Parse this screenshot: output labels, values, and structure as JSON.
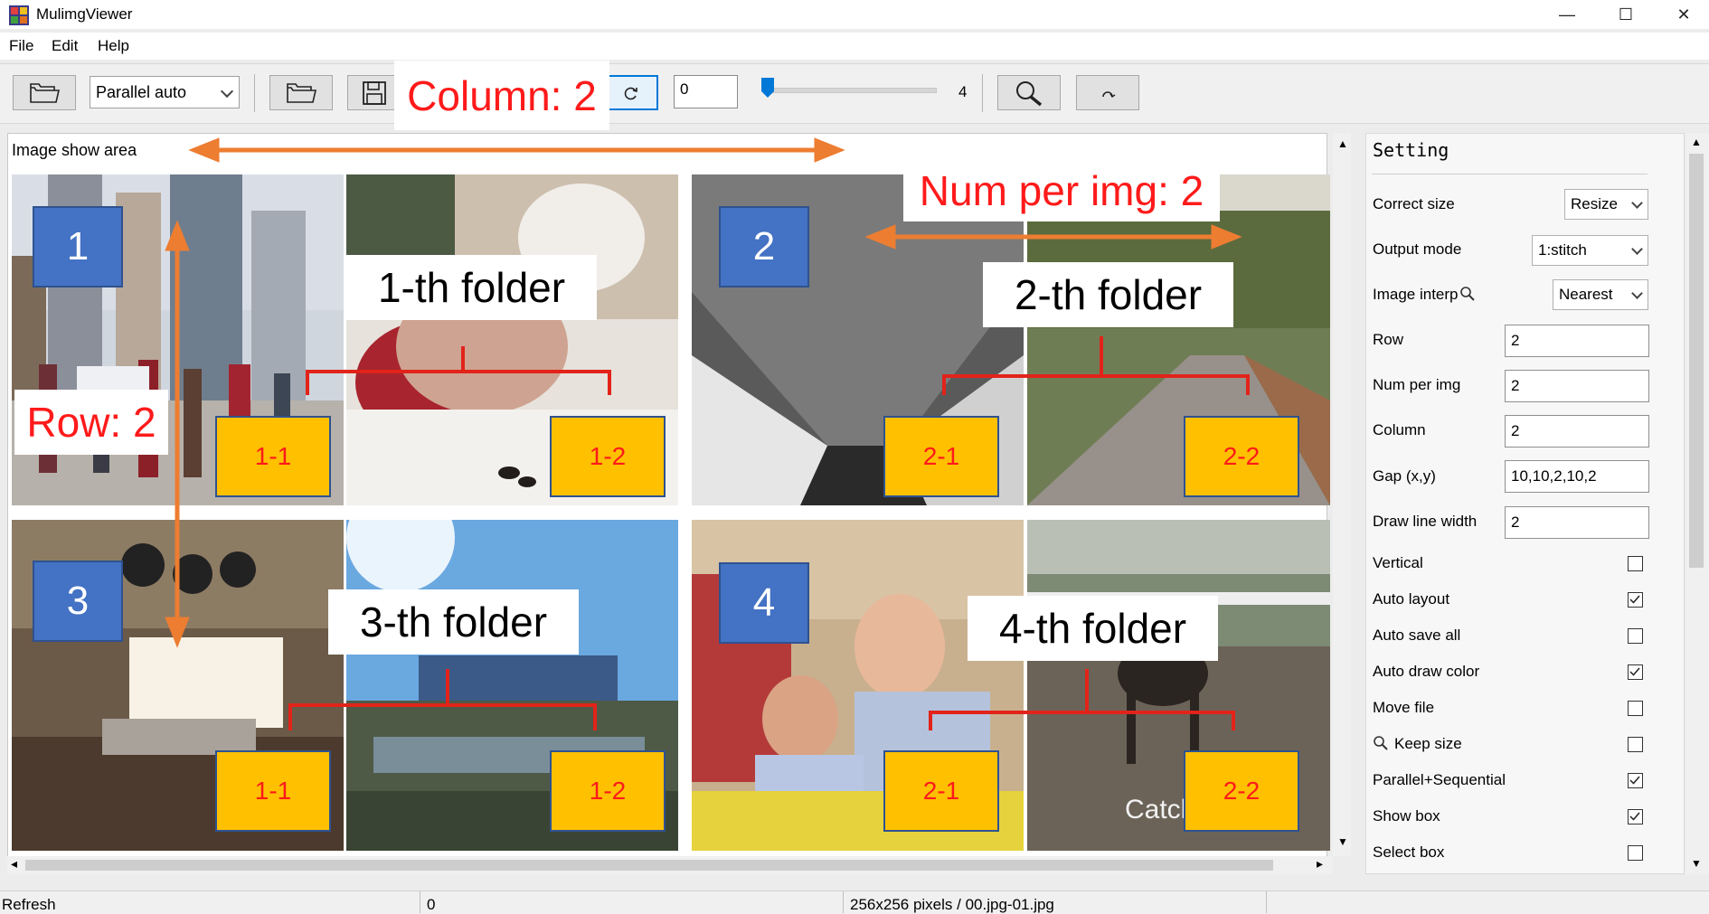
{
  "window": {
    "title": "MulimgViewer",
    "minimize": "—",
    "maximize": "☐",
    "close": "✕"
  },
  "menu": [
    "File",
    "Edit",
    "Help"
  ],
  "toolbar": {
    "mode": "Parallel auto",
    "frame_value": "0",
    "slider_value": "4",
    "slider_position": 0.0
  },
  "image_area": {
    "label": "Image show area"
  },
  "annotations": {
    "column": "Column: 2",
    "row": "Row: 2",
    "num_per_img": "Num per img: 2",
    "folders": [
      "1-th folder",
      "2-th folder",
      "3-th folder",
      "4-th folder"
    ],
    "numbers": [
      "1",
      "2",
      "3",
      "4"
    ],
    "tiles": [
      "1-1",
      "1-2",
      "2-1",
      "2-2",
      "1-1",
      "1-2",
      "2-1",
      "2-2"
    ],
    "watermark": "CatchaM"
  },
  "setting": {
    "title": "Setting",
    "correct_size": {
      "label": "Correct size",
      "value": "Resize"
    },
    "output_mode": {
      "label": "Output mode",
      "value": "1:stitch"
    },
    "image_interp": {
      "label": "Image interp",
      "value": "Nearest"
    },
    "row": {
      "label": "Row",
      "value": "2"
    },
    "num_per_img": {
      "label": "Num per img",
      "value": "2"
    },
    "column": {
      "label": "Column",
      "value": "2"
    },
    "gap": {
      "label": "Gap (x,y)",
      "value": "10,10,2,10,2"
    },
    "draw_line_width": {
      "label": "Draw line width",
      "value": "2"
    },
    "checkboxes": [
      {
        "label": "Vertical",
        "checked": false
      },
      {
        "label": "Auto layout",
        "checked": true
      },
      {
        "label": "Auto save all",
        "checked": false
      },
      {
        "label": "Auto draw color",
        "checked": true
      },
      {
        "label": "Move file",
        "checked": false
      },
      {
        "label": "Keep size",
        "checked": false
      },
      {
        "label": "Parallel+Sequential",
        "checked": true
      },
      {
        "label": "Show box",
        "checked": true
      },
      {
        "label": "Select box",
        "checked": false
      }
    ]
  },
  "status": {
    "left": "Refresh",
    "middle": "0",
    "right": "256x256 pixels / 00.jpg-01.jpg"
  },
  "colors": {
    "accent_red": "#ff1a1a",
    "orange": "#ed7d31",
    "badge_blue": "#4472c4",
    "badge_yellow": "#ffc000"
  }
}
